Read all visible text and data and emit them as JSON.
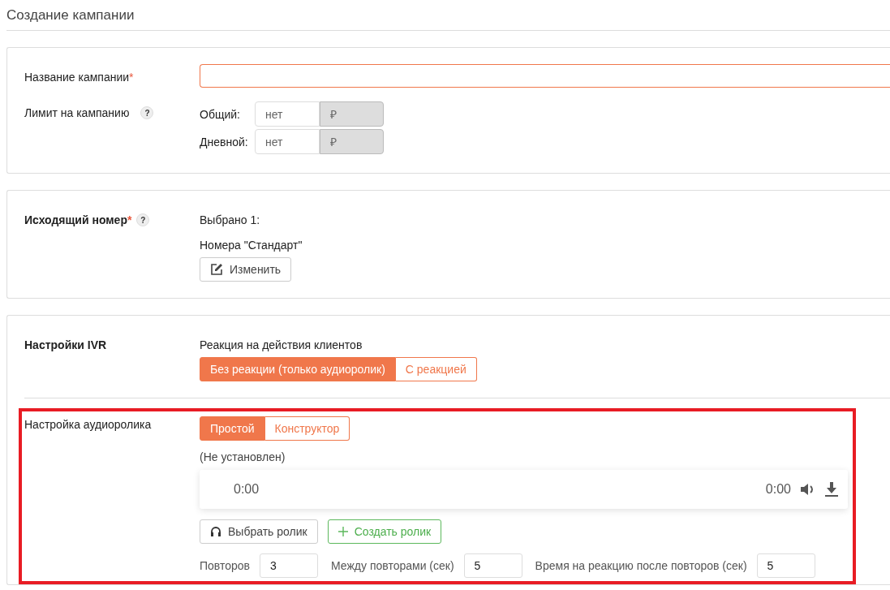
{
  "page_title": "Создание кампании",
  "campaign": {
    "name_label": "Название кампании",
    "required_mark": "*",
    "name_field": {
      "focused": true
    },
    "limit_label": "Лимит на кампанию",
    "limit_help": "?",
    "limits": [
      {
        "label": "Общий:",
        "placeholder": "нет",
        "currency": "₽"
      },
      {
        "label": "Дневной:",
        "placeholder": "нет",
        "currency": "₽"
      }
    ]
  },
  "caller": {
    "label": "Исходящий номер",
    "required_mark": "*",
    "help": "?",
    "selected_count": "Выбрано 1:",
    "selection": "Номера \"Стандарт\"",
    "edit_button": "Изменить"
  },
  "ivr": {
    "label": "Настройки IVR",
    "reaction_label": "Реакция на действия клиентов",
    "reaction_options": [
      {
        "label": "Без реакции (только аудиоролик)",
        "selected": true
      },
      {
        "label": "С реакцией",
        "selected": false
      }
    ],
    "audio_label": "Настройка аудиоролика",
    "audio_modes": [
      {
        "label": "Простой",
        "selected": true
      },
      {
        "label": "Конструктор",
        "selected": false
      }
    ],
    "audio_status": "(Не установлен)",
    "player": {
      "current_time": "0:00",
      "duration": "0:00"
    },
    "choose_button": "Выбрать ролик",
    "create_button": "Создать ролик",
    "repeat_fields": [
      {
        "label": "Повторов",
        "value": "3"
      },
      {
        "label": "Между повторами (сек)",
        "value": "5"
      },
      {
        "label": "Время на реакцию после повторов (сек)",
        "value": "5"
      }
    ]
  }
}
